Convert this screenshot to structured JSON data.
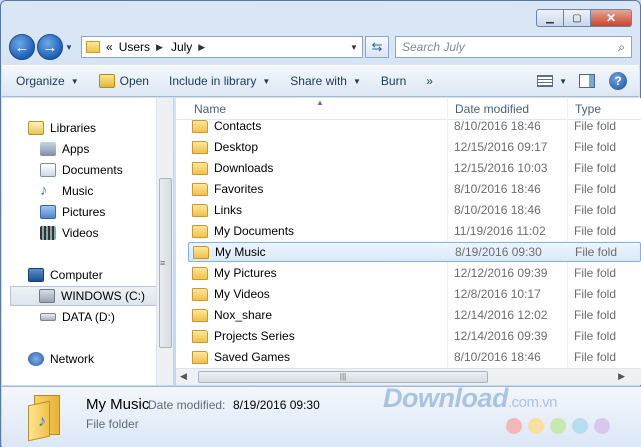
{
  "address": {
    "chevron": "«",
    "segments": [
      "Users",
      "July"
    ],
    "separator_icon": "breadcrumb-arrow-icon"
  },
  "search": {
    "placeholder": "Search July"
  },
  "toolbar": {
    "organize": "Organize",
    "open": "Open",
    "include_in_library": "Include in library",
    "share_with": "Share with",
    "burn": "Burn",
    "more": "»"
  },
  "nav": {
    "libraries": "Libraries",
    "apps": "Apps",
    "documents": "Documents",
    "music": "Music",
    "pictures": "Pictures",
    "videos": "Videos",
    "computer": "Computer",
    "windows_c": "WINDOWS (C:)",
    "data_d": "DATA (D:)",
    "network": "Network"
  },
  "columns": {
    "name": "Name",
    "date_modified": "Date modified",
    "type": "Type"
  },
  "files": [
    {
      "name": "Contacts",
      "date": "8/10/2016 18:46",
      "type": "File fold"
    },
    {
      "name": "Desktop",
      "date": "12/15/2016 09:17",
      "type": "File fold"
    },
    {
      "name": "Downloads",
      "date": "12/15/2016 10:03",
      "type": "File fold"
    },
    {
      "name": "Favorites",
      "date": "8/10/2016 18:46",
      "type": "File fold"
    },
    {
      "name": "Links",
      "date": "8/10/2016 18:46",
      "type": "File fold"
    },
    {
      "name": "My Documents",
      "date": "11/19/2016 11:02",
      "type": "File fold"
    },
    {
      "name": "My Music",
      "date": "8/19/2016 09:30",
      "type": "File fold"
    },
    {
      "name": "My Pictures",
      "date": "12/12/2016 09:39",
      "type": "File fold"
    },
    {
      "name": "My Videos",
      "date": "12/8/2016 10:17",
      "type": "File fold"
    },
    {
      "name": "Nox_share",
      "date": "12/14/2016 12:02",
      "type": "File fold"
    },
    {
      "name": "Projects Series",
      "date": "12/14/2016 09:39",
      "type": "File fold"
    },
    {
      "name": "Saved Games",
      "date": "8/10/2016 18:46",
      "type": "File fold"
    }
  ],
  "selected_file": "My Music",
  "details": {
    "name": "My Music",
    "date_modified_label": "Date modified:",
    "date_modified_value": "8/19/2016 09:30",
    "type": "File folder"
  },
  "watermark": {
    "text": "Download",
    "suffix": ".com.vn"
  },
  "colors": {
    "accent": "#1d5fb8",
    "selection": "#d9e9fb",
    "watermark_dots": [
      "#f2b8b8",
      "#f8e0a0",
      "#c8e8b0",
      "#b8dcf0",
      "#d8c8ec"
    ]
  }
}
